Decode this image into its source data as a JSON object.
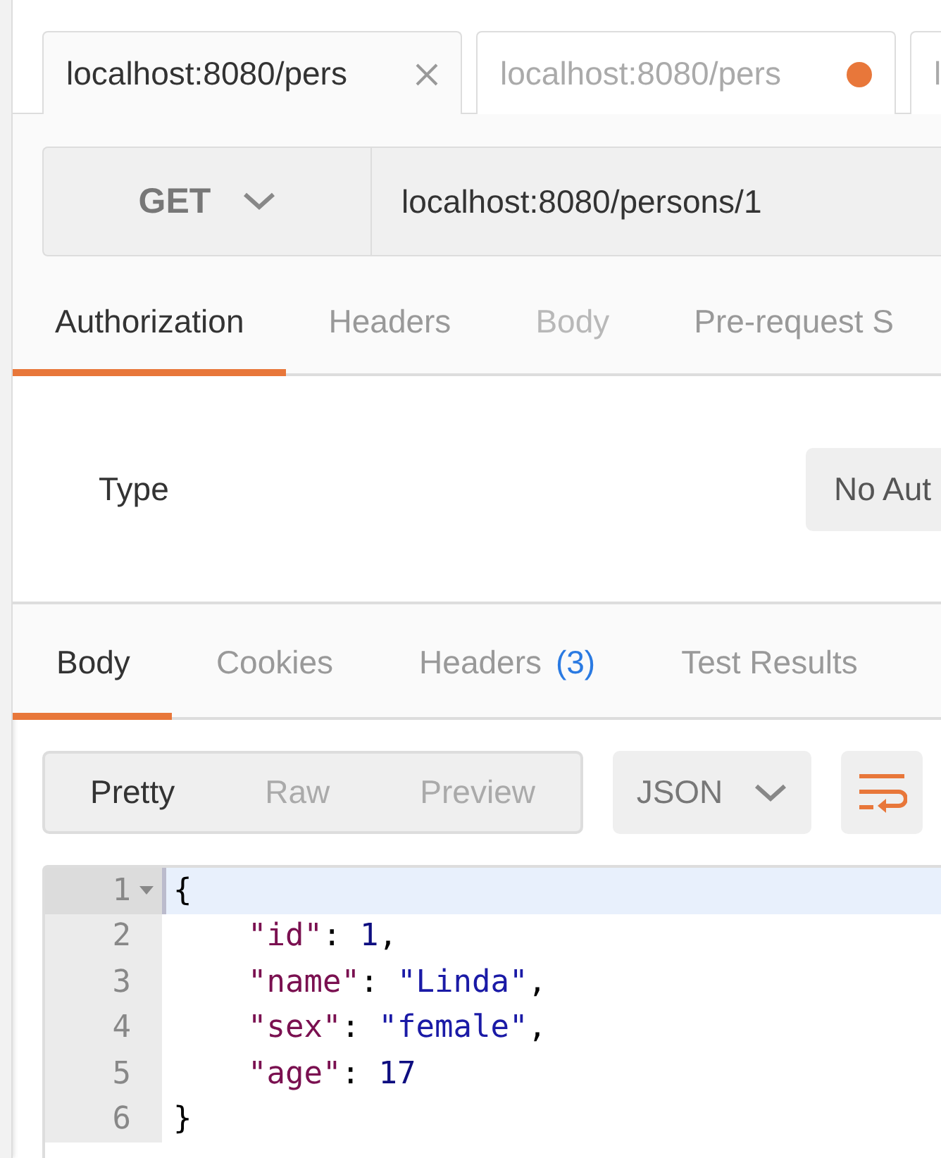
{
  "tabs": [
    {
      "label": "localhost:8080/pers",
      "selected": true,
      "unsaved": false
    },
    {
      "label": "localhost:8080/pers",
      "selected": false,
      "unsaved": true
    },
    {
      "label": "l",
      "selected": false,
      "unsaved": false
    }
  ],
  "request": {
    "method": "GET",
    "url": "localhost:8080/persons/1"
  },
  "request_tabs": [
    {
      "label": "Authorization",
      "selected": true,
      "disabled": false
    },
    {
      "label": "Headers",
      "selected": false,
      "disabled": false
    },
    {
      "label": "Body",
      "selected": false,
      "disabled": true
    },
    {
      "label": "Pre-request S",
      "selected": false,
      "disabled": false
    }
  ],
  "authorization": {
    "type_label": "Type",
    "type_value": "No Aut"
  },
  "response_tabs": [
    {
      "label": "Body",
      "selected": true
    },
    {
      "label": "Cookies",
      "selected": false
    },
    {
      "label": "Headers",
      "count": "(3)",
      "selected": false
    },
    {
      "label": "Test Results",
      "selected": false
    }
  ],
  "view_modes": [
    {
      "label": "Pretty",
      "selected": true
    },
    {
      "label": "Raw",
      "selected": false
    },
    {
      "label": "Preview",
      "selected": false
    }
  ],
  "format": "JSON",
  "code_lines": [
    {
      "number": "1",
      "highlighted": true,
      "foldable": true,
      "indented": false,
      "tokens": [
        {
          "kind": "punct",
          "text": "{"
        }
      ]
    },
    {
      "number": "2",
      "highlighted": false,
      "foldable": false,
      "indented": true,
      "tokens": [
        {
          "kind": "key",
          "text": "\"id\""
        },
        {
          "kind": "punct",
          "text": ": "
        },
        {
          "kind": "number",
          "text": "1"
        },
        {
          "kind": "punct",
          "text": ","
        }
      ]
    },
    {
      "number": "3",
      "highlighted": false,
      "foldable": false,
      "indented": true,
      "tokens": [
        {
          "kind": "key",
          "text": "\"name\""
        },
        {
          "kind": "punct",
          "text": ": "
        },
        {
          "kind": "string",
          "text": "\"Linda\""
        },
        {
          "kind": "punct",
          "text": ","
        }
      ]
    },
    {
      "number": "4",
      "highlighted": false,
      "foldable": false,
      "indented": true,
      "tokens": [
        {
          "kind": "key",
          "text": "\"sex\""
        },
        {
          "kind": "punct",
          "text": ": "
        },
        {
          "kind": "string",
          "text": "\"female\""
        },
        {
          "kind": "punct",
          "text": ","
        }
      ]
    },
    {
      "number": "5",
      "highlighted": false,
      "foldable": false,
      "indented": true,
      "tokens": [
        {
          "kind": "key",
          "text": "\"age\""
        },
        {
          "kind": "punct",
          "text": ": "
        },
        {
          "kind": "number",
          "text": "17"
        }
      ]
    },
    {
      "number": "6",
      "highlighted": false,
      "foldable": false,
      "indented": false,
      "tokens": [
        {
          "kind": "punct",
          "text": "}"
        }
      ]
    }
  ]
}
